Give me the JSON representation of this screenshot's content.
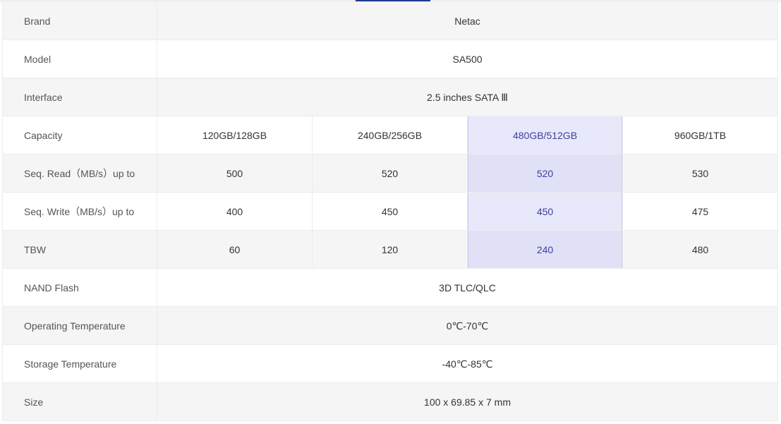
{
  "selected_column_index": 2,
  "colors": {
    "highlight_bg": "#e0e0f7",
    "highlight_text": "#3e3e9e",
    "tab_indicator": "#1f3a93"
  },
  "specs": {
    "brand": {
      "label": "Brand",
      "value": "Netac"
    },
    "model": {
      "label": "Model",
      "value": "SA500"
    },
    "interface": {
      "label": "Interface",
      "value": "2.5 inches SATA Ⅲ"
    },
    "capacity": {
      "label": "Capacity",
      "values": [
        "120GB/128GB",
        "240GB/256GB",
        "480GB/512GB",
        "960GB/1TB"
      ]
    },
    "seq_read": {
      "label": "Seq. Read（MB/s）up to",
      "values": [
        "500",
        "520",
        "520",
        "530"
      ]
    },
    "seq_write": {
      "label": "Seq. Write（MB/s）up to",
      "values": [
        "400",
        "450",
        "450",
        "475"
      ]
    },
    "tbw": {
      "label": "TBW",
      "values": [
        "60",
        "120",
        "240",
        "480"
      ]
    },
    "nand_flash": {
      "label": "NAND Flash",
      "value": "3D TLC/QLC"
    },
    "operating_temperature": {
      "label": "Operating Temperature",
      "value": "0℃-70℃"
    },
    "storage_temperature": {
      "label": "Storage Temperature",
      "value": "-40℃-85℃"
    },
    "size": {
      "label": "Size",
      "value": "100 x 69.85 x 7 mm"
    }
  }
}
